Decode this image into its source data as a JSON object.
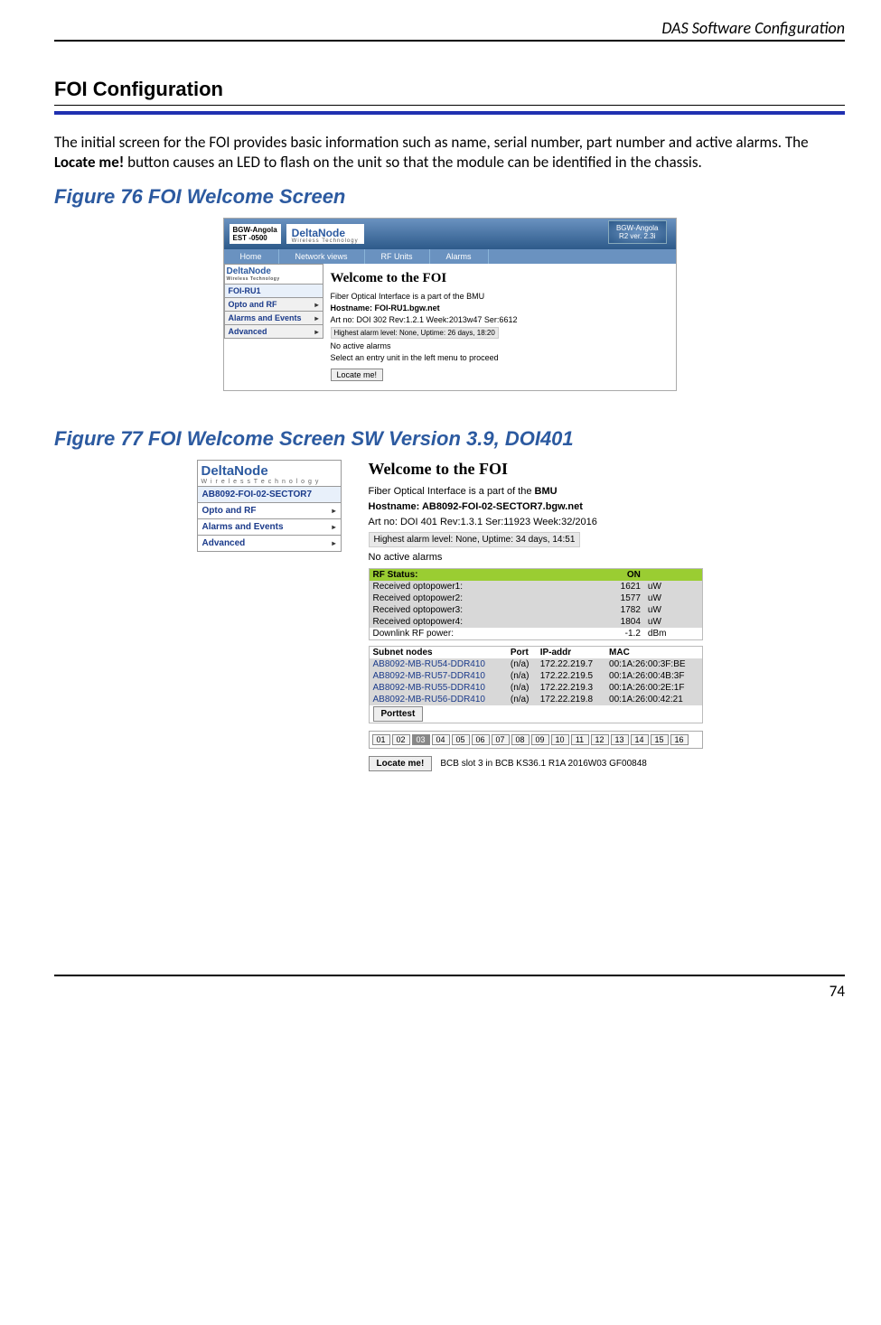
{
  "header": {
    "title": "DAS Software Configuration"
  },
  "section": {
    "title": "FOI Configuration"
  },
  "para1": "The initial screen for the FOI provides basic information such as name, serial number, part number and active alarms. The ",
  "para1_bold": "Locate me!",
  "para1_tail": " button causes an LED to flash on the unit so that the module can be identified in the chassis.",
  "fig76": {
    "caption": "Figure 76    FOI Welcome Screen",
    "top_left_l1": "BGW-Angola",
    "top_left_l2": "EST -0500",
    "logo": "DeltaNode",
    "logo_sub": "Wireless Technology",
    "badge_l1": "BGW-Angola",
    "badge_l2": "R2 ver. 2.3i",
    "nav": [
      "Home",
      "Network views",
      "RF Units",
      "Alarms"
    ],
    "side_items": [
      "FOI-RU1",
      "Opto and RF",
      "Alarms and Events",
      "Advanced"
    ],
    "main_title": "Welcome to the FOI",
    "sub1": "Fiber Optical Interface is a part of the BMU",
    "host_label": "Hostname: FOI-RU1.bgw.net",
    "art": "Art no: DOI 302 Rev:1.2.1 Week:2013w47 Ser:6612",
    "alarm_strip": "Highest alarm level: None,  Uptime: 26 days, 18:20",
    "noalarm": "No active alarms",
    "select_msg": "Select an entry unit in the left menu to proceed",
    "locate_btn": "Locate me!"
  },
  "fig77": {
    "caption": "Figure 77    FOI Welcome Screen SW Version 3.9, DOI401",
    "logo": "DeltaNode",
    "logo_sub": "W i r e l e s s   T e c h n o l o g y",
    "side_items": [
      "AB8092-FOI-02-SECTOR7",
      "Opto and RF",
      "Alarms and Events",
      "Advanced"
    ],
    "main_title": "Welcome to the FOI",
    "sub1_a": "Fiber Optical Interface is a part of the ",
    "sub1_b": "BMU",
    "host_label": "Hostname: AB8092-FOI-02-SECTOR7.bgw.net",
    "art": "Art no: DOI 401 Rev:1.3.1 Ser:11923 Week:32/2016",
    "alarm_strip": "Highest alarm level:  None,   Uptime: 34 days, 14:51",
    "noalarm": "No active alarms",
    "rf_hdr_l": "RF Status:",
    "rf_hdr_r": "ON",
    "rf_rows": [
      {
        "l": "Received optopower1:",
        "v": "1621",
        "u": "uW"
      },
      {
        "l": "Received optopower2:",
        "v": "1577",
        "u": "uW"
      },
      {
        "l": "Received optopower3:",
        "v": "1782",
        "u": "uW"
      },
      {
        "l": "Received optopower4:",
        "v": "1804",
        "u": "uW"
      }
    ],
    "dl_row": {
      "l": "Downlink RF power:",
      "v": "-1.2",
      "u": "dBm"
    },
    "subnet_hdr": [
      "Subnet nodes",
      "Port",
      "IP-addr",
      "MAC"
    ],
    "subnet_rows": [
      {
        "n": "AB8092-MB-RU54-DDR410",
        "p": "(n/a)",
        "ip": "172.22.219.7",
        "mac": "00:1A:26:00:3F:BE"
      },
      {
        "n": "AB8092-MB-RU57-DDR410",
        "p": "(n/a)",
        "ip": "172.22.219.5",
        "mac": "00:1A:26:00:4B:3F"
      },
      {
        "n": "AB8092-MB-RU55-DDR410",
        "p": "(n/a)",
        "ip": "172.22.219.3",
        "mac": "00:1A:26:00:2E:1F"
      },
      {
        "n": "AB8092-MB-RU56-DDR410",
        "p": "(n/a)",
        "ip": "172.22.219.8",
        "mac": "00:1A:26:00:42:21"
      }
    ],
    "porttest_btn": "Porttest",
    "ports": [
      "01",
      "02",
      "03",
      "04",
      "05",
      "06",
      "07",
      "08",
      "09",
      "10",
      "11",
      "12",
      "13",
      "14",
      "15",
      "16"
    ],
    "active_port": "03",
    "locate_btn": "Locate me!",
    "locate_tail": "BCB slot 3 in BCB KS36.1 R1A 2016W03 GF00848"
  },
  "footer": {
    "page": "74"
  }
}
